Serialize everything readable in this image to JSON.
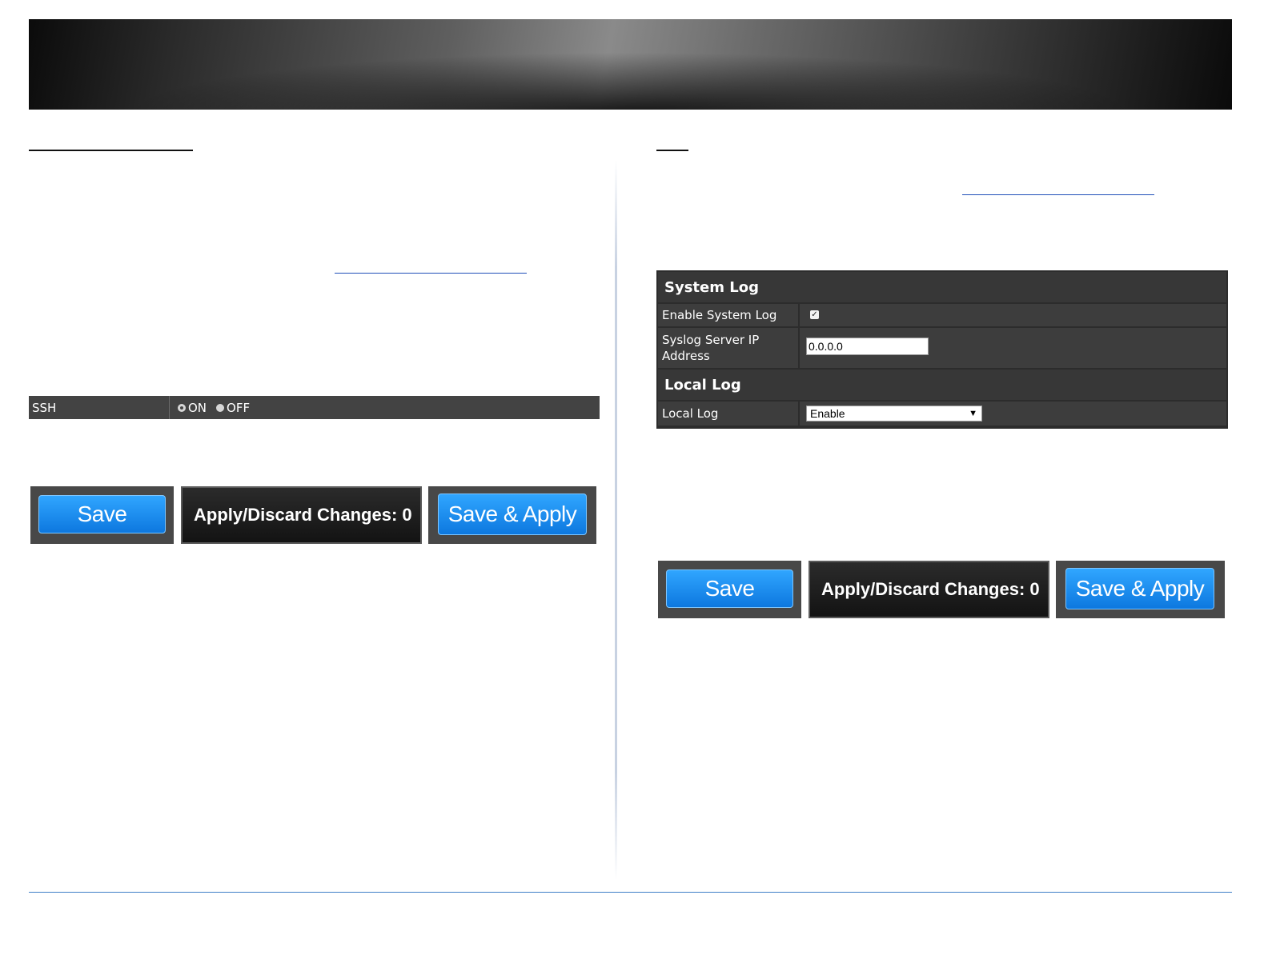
{
  "ssh": {
    "label": "SSH",
    "options": [
      {
        "label": "ON",
        "selected": true
      },
      {
        "label": "OFF",
        "selected": false
      }
    ]
  },
  "left_actions": {
    "save": "Save",
    "apply_discard": "Apply/Discard Changes: 0",
    "save_apply": "Save & Apply"
  },
  "system_log": {
    "header": "System Log",
    "enable_label": "Enable System Log",
    "enable_checked": true,
    "server_ip_label": "Syslog Server IP Address",
    "server_ip_value": "0.0.0.0"
  },
  "local_log": {
    "header": "Local Log",
    "label": "Local Log",
    "selected": "Enable"
  },
  "right_actions": {
    "save": "Save",
    "apply_discard": "Apply/Discard Changes: 0",
    "save_apply": "Save & Apply"
  },
  "colors": {
    "accent_blue": "#1a8cf0",
    "panel_dark": "#3d3d3d",
    "link_blue": "#1f4fb8"
  }
}
